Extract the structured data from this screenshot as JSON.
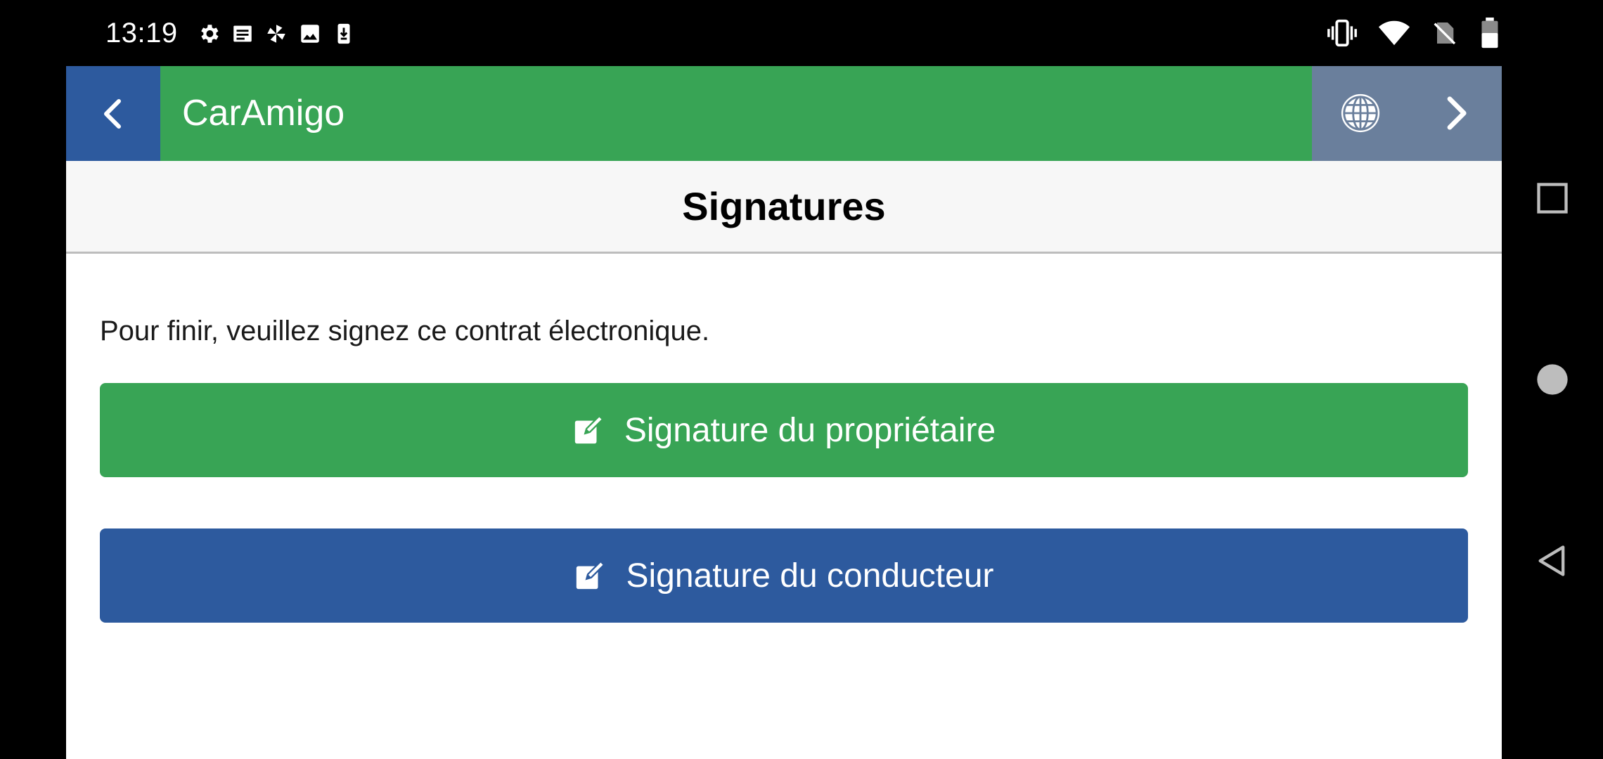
{
  "status_bar": {
    "time": "13:19",
    "left_icons": [
      "settings-icon",
      "news-icon",
      "pinwheel-icon",
      "image-icon",
      "download-icon"
    ],
    "right_icons": [
      "vibrate-icon",
      "wifi-icon",
      "no-sim-icon",
      "battery-icon"
    ]
  },
  "app_bar": {
    "title": "CarAmigo",
    "back_icon": "chevron-left-icon",
    "language_icon": "globe-icon",
    "next_icon": "chevron-right-icon"
  },
  "page": {
    "title": "Signatures",
    "instructions": "Pour finir, veuillez signez ce contrat électronique."
  },
  "buttons": {
    "owner": {
      "label": "Signature du propriétaire",
      "icon": "edit-icon"
    },
    "driver": {
      "label": "Signature du conducteur",
      "icon": "edit-icon"
    }
  },
  "colors": {
    "green": "#38a455",
    "blue": "#2d5a9e",
    "slate": "#6a7f9c",
    "header_bg": "#f7f7f7"
  },
  "nav_bar": [
    "recent-apps-icon",
    "home-icon",
    "back-icon"
  ]
}
